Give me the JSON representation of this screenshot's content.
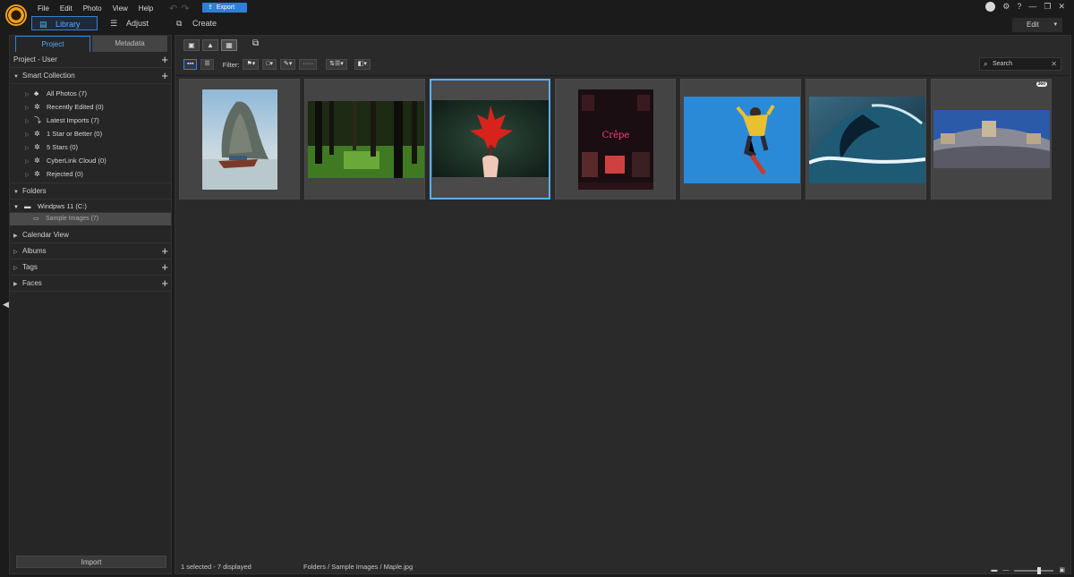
{
  "menu": [
    "File",
    "Edit",
    "Photo",
    "View",
    "Help"
  ],
  "export_label": "Export",
  "modes": {
    "library": "Library",
    "adjust": "Adjust",
    "create": "Create"
  },
  "edit_dropdown": "Edit",
  "left_tabs": {
    "project": "Project",
    "metadata": "Metadata"
  },
  "project_user": "Project - User",
  "smart_collection": {
    "title": "Smart Collection",
    "items": [
      "All Photos (7)",
      "Recently Edited (0)",
      "Latest Imports (7)",
      "1 Star or Better (0)",
      "5 Stars (0)",
      "CyberLink Cloud (0)",
      "Rejected (0)"
    ]
  },
  "folders": {
    "title": "Folders",
    "drive": "Windpws 11 (C:)",
    "subfolder": "Sample Images (7)"
  },
  "sections": [
    "Calendar View",
    "Albums",
    "Tags",
    "Faces"
  ],
  "import_label": "Import",
  "filter_label": "Filter:",
  "search_placeholder": "Search",
  "thumbnails": [
    {
      "name": "rock-island"
    },
    {
      "name": "forest"
    },
    {
      "name": "maple",
      "selected": true
    },
    {
      "name": "neon-cafe"
    },
    {
      "name": "skateboarder"
    },
    {
      "name": "wave"
    },
    {
      "name": "panorama-360",
      "badge": "360"
    }
  ],
  "status": {
    "count": "1 selected - 7 displayed",
    "path": "Folders / Sample Images / Maple.jpg"
  },
  "accent": "#5aa8ff"
}
